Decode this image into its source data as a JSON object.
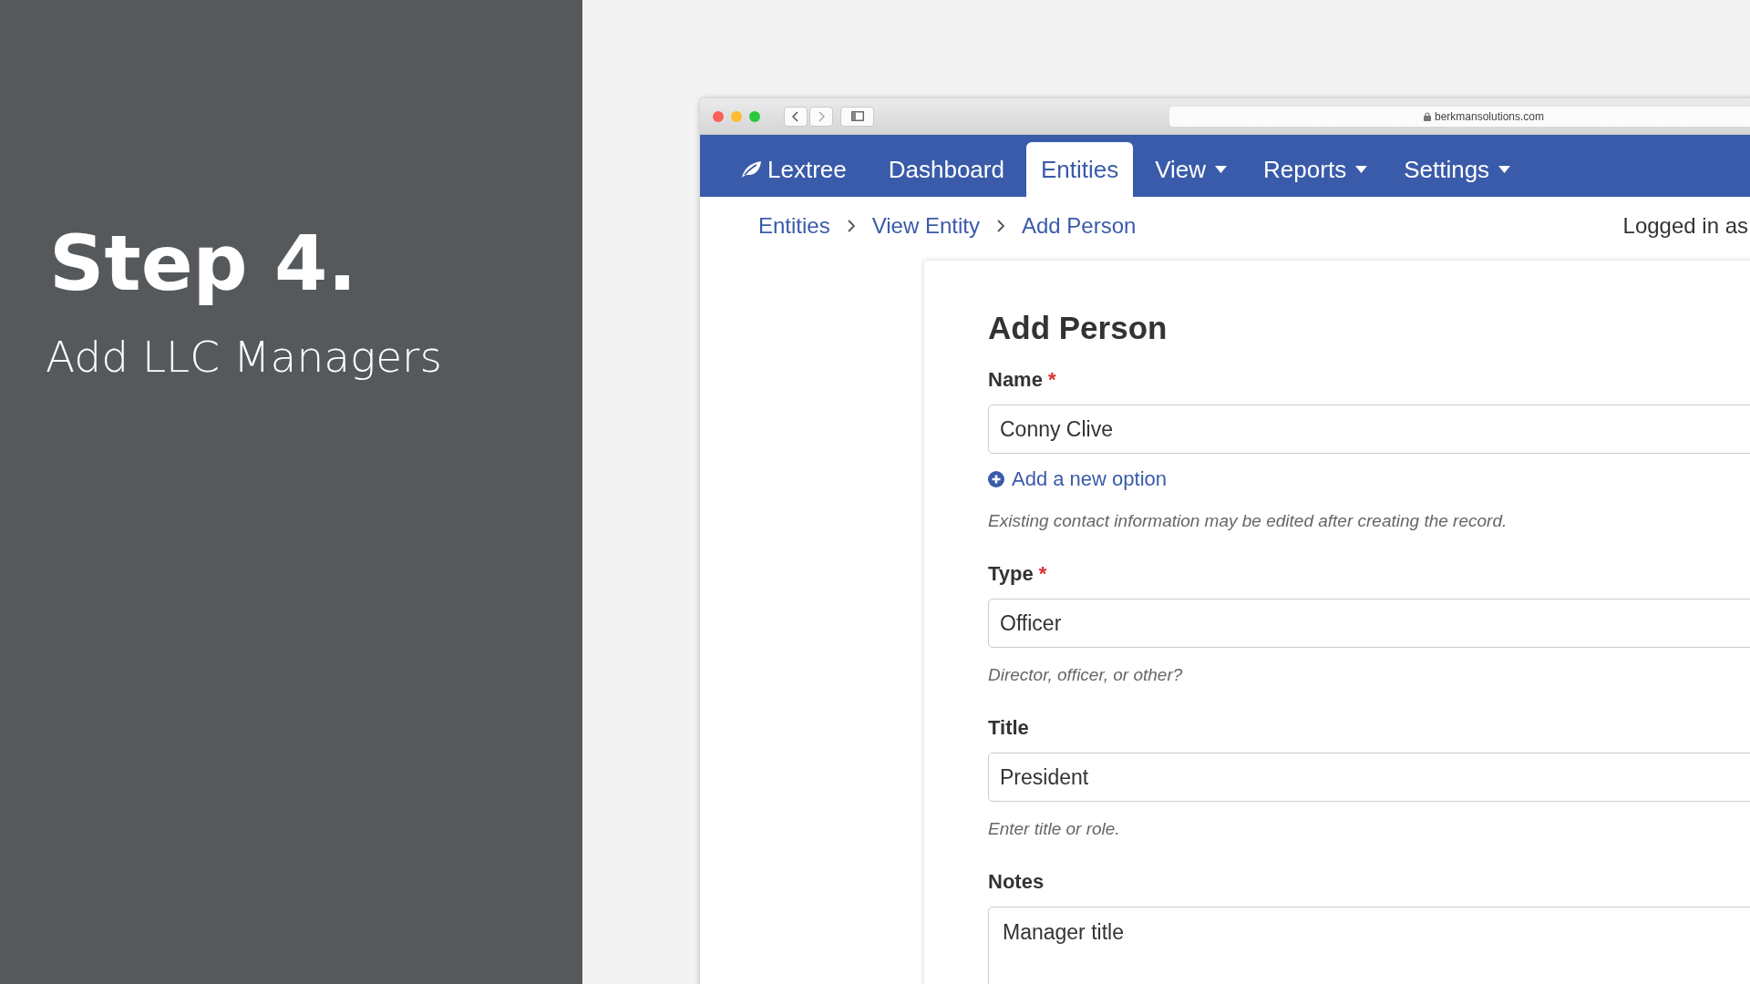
{
  "slide": {
    "heading": "Step 4.",
    "subheading": "Add LLC Managers"
  },
  "browser": {
    "url": "berkmansolutions.com"
  },
  "navbar": {
    "brand": "Lextree",
    "items": [
      {
        "label": "Dashboard",
        "selected": false,
        "dropdown": false
      },
      {
        "label": "Entities",
        "selected": true,
        "dropdown": false
      },
      {
        "label": "View",
        "selected": false,
        "dropdown": true
      },
      {
        "label": "Reports",
        "selected": false,
        "dropdown": true
      },
      {
        "label": "Settings",
        "selected": false,
        "dropdown": true
      }
    ]
  },
  "breadcrumb": [
    "Entities",
    "View Entity",
    "Add Person"
  ],
  "user_status": "Logged in as",
  "form": {
    "title": "Add Person",
    "fields": [
      {
        "kind": "input",
        "label": "Name",
        "required_mark": "*",
        "value": "Conny Clive",
        "add_option": "Add a new option",
        "help": "Existing contact information may be edited after creating the record."
      },
      {
        "kind": "input",
        "label": "Type",
        "required_mark": "*",
        "value": "Officer",
        "help": "Director, officer, or other?"
      },
      {
        "kind": "input",
        "label": "Title",
        "value": "President",
        "help": "Enter title or role."
      },
      {
        "kind": "textarea",
        "label": "Notes",
        "value": "Manager title"
      }
    ]
  }
}
